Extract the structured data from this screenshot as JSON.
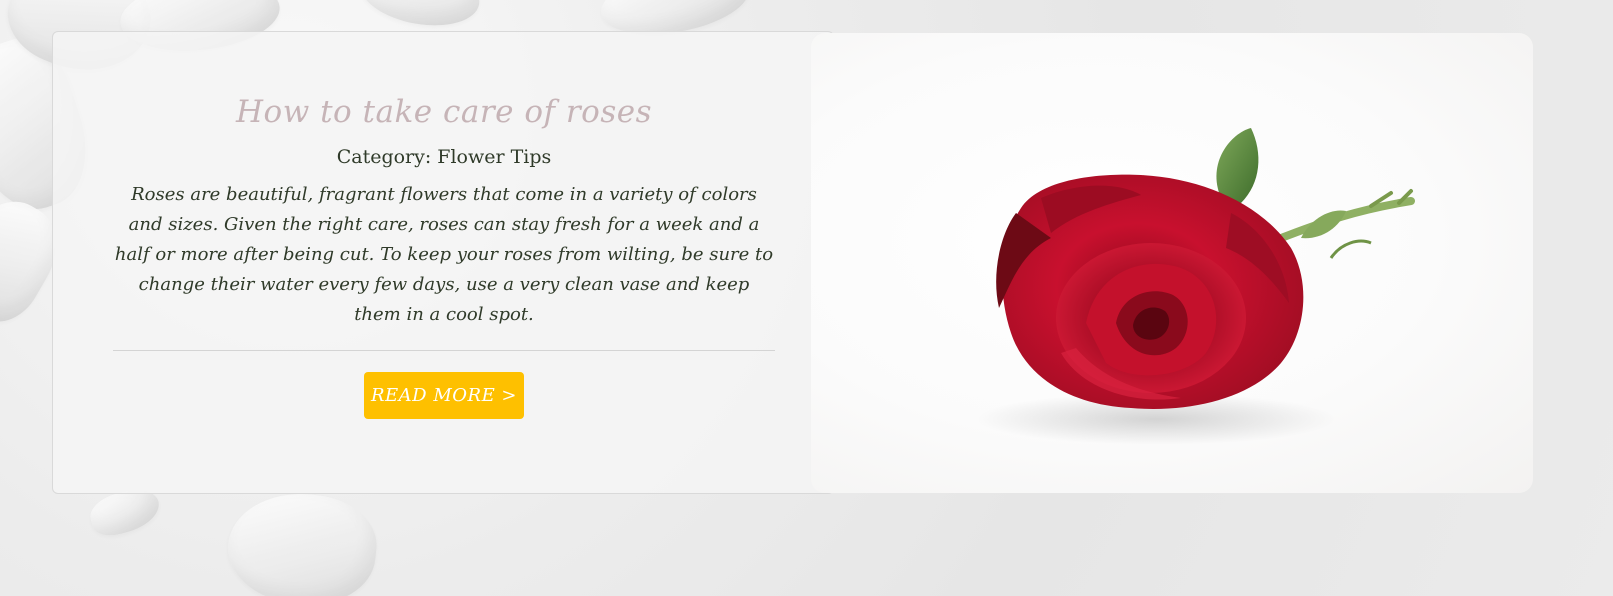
{
  "post": {
    "title": "How to take care of roses",
    "category_label": "Category:",
    "category_value": "Flower Tips",
    "body": "Roses are beautiful, fragrant flowers that come in a variety of colors and sizes. Given the right care, roses can stay fresh for a week and a half or more after being cut. To keep your roses from wilting, be sure to change their water every few days, use a very clean vase and keep them in a cool spot.",
    "read_more_label": "READ MORE >",
    "image_subject": "red-rose"
  },
  "colors": {
    "title": "#c6b4b7",
    "text": "#2f3a29",
    "button": "#fec000",
    "button_text": "#ffffff",
    "rose": "#c8102e"
  }
}
